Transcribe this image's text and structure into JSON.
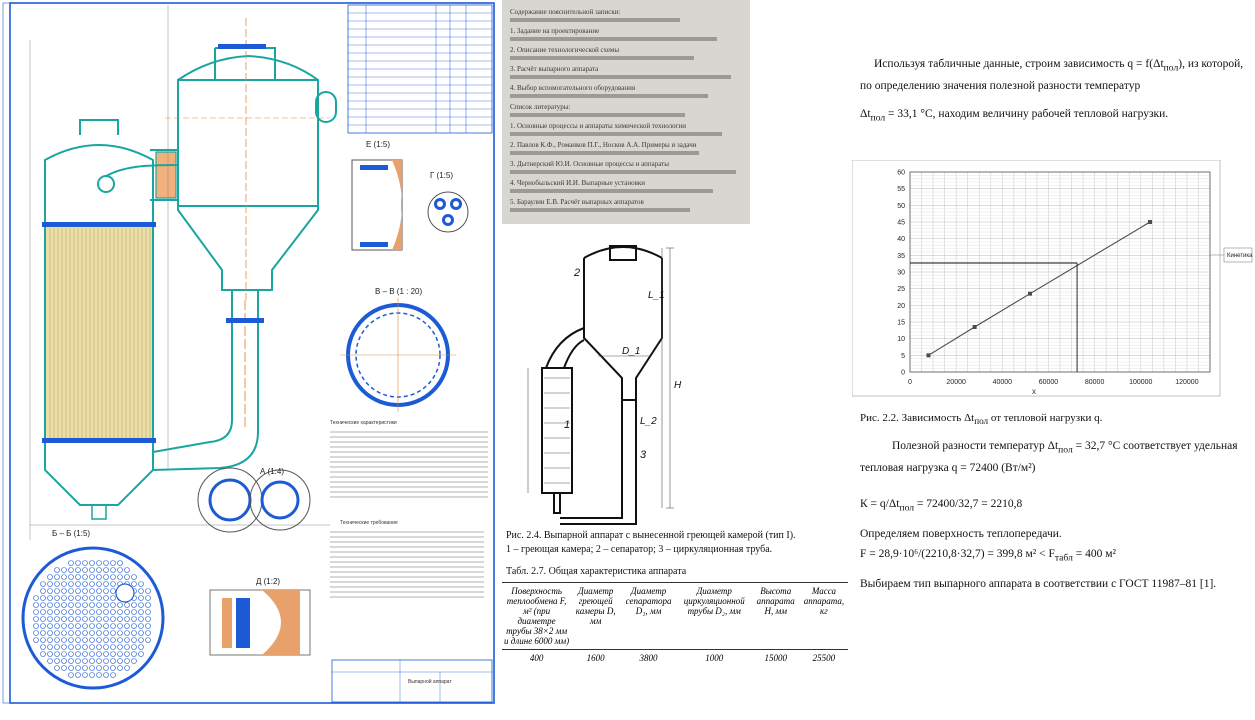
{
  "drawing": {
    "section_labels": [
      "Е (1:5)",
      "Г (1:5)",
      "В – В (1 : 20)",
      "Б – Б (1:5)",
      "А (1:4)",
      "Д (1:2)"
    ],
    "spec_table_rows": 16,
    "notes_title_1": "Технические характеристики",
    "notes_title_2": "Технические требования",
    "title_block": "Выпарной аппарат"
  },
  "scan": {
    "lines": [
      "Содержание пояснительной записки:",
      "1. Задание на проектирование",
      "2. Описание технологической схемы",
      "3. Расчёт выпарного аппарата",
      "4. Выбор вспомогательного оборудования",
      "Список литературы:",
      "1. Основные процессы и аппараты химической технологии",
      "2. Павлов К.Ф., Романков П.Г., Носков А.А. Примеры и задачи",
      "3. Дытнерский Ю.И. Основные процессы и аппараты",
      "4. Чернобыльский И.И. Выпарные установки",
      "5. Бараулин Е.В. Расчёт выпарных аппаратов"
    ]
  },
  "figure": {
    "labels": [
      "1",
      "2",
      "3",
      "D_1",
      "L_1",
      "L_2",
      "H"
    ],
    "caption_1": "Рис. 2.4. Выпарной аппарат с вынесенной греющей камерой (тип I).",
    "caption_2": "1 – греющая камера; 2 – сепаратор; 3 – циркуляционная труба.",
    "table_title": "Табл. 2.7. Общая характеристика аппарата",
    "table": {
      "headers": [
        "Поверхность теплообмена F, м² (при диаметре трубы 38×2 мм и длине 6000 мм)",
        "Диаметр греющей камеры D, мм",
        "Диаметр сепаратора D₁, мм",
        "Диаметр циркуляционной трубы D₂, мм",
        "Высота аппарата Н, мм",
        "Масса аппарата, кг"
      ],
      "values": [
        "400",
        "1600",
        "3800",
        "1000",
        "15000",
        "25500"
      ]
    }
  },
  "text": {
    "p1a": "Используя табличные данные, строим зависимость q = f(Δt",
    "p1a_sub": "пол",
    "p1a_end": "), из которой,",
    "p1b": "по определению значения полезной разности температур",
    "p2_pre": "Δt",
    "p2_sub": "пол",
    "p2_rest": " = 33,1 °С, находим величину рабочей тепловой нагрузки.",
    "fig_caption": "Рис. 2.2. Зависимость Δt",
    "fig_caption_sub": "пол",
    "fig_caption_end": " от тепловой нагрузки q.",
    "p3a": "Полезной разности температур  Δt",
    "p3a_sub": "пол",
    "p3a_end": " = 32,7 °С  соответствует удельная",
    "p3b": "тепловая нагрузка  q = 72400 (Вт/м²)",
    "p4": "К = q/Δt",
    "p4_sub": "пол",
    "p4_end": " = 72400/32,7 = 2210,8",
    "p5": "Определяем поверхность теплопередачи.",
    "p6": "F = 28,9·10⁶/(2210,8·32,7) = 399,8 м² < F",
    "p6_sub": "табл",
    "p6_end": " = 400 м²",
    "p7": "Выбираем тип выпарного аппарата в соответствии с ГОСТ 11987–81 [1]."
  },
  "chart_data": {
    "type": "line",
    "title": "",
    "xlabel": "x",
    "ylabel": "",
    "x_ticks": [
      0,
      20000,
      40000,
      60000,
      80000,
      100000,
      120000
    ],
    "y_ticks": [
      0,
      5,
      10,
      15,
      20,
      25,
      30,
      35,
      40,
      45,
      50,
      55,
      60
    ],
    "xlim": [
      0,
      130000
    ],
    "ylim": [
      0,
      60
    ],
    "grid": true,
    "legend": "right",
    "series": [
      {
        "name": "Кинетика",
        "x": [
          8000,
          28000,
          52000,
          104000
        ],
        "y": [
          5,
          13.5,
          23.5,
          45
        ]
      }
    ],
    "annotation": {
      "x": 72400,
      "y": 32.7
    }
  }
}
